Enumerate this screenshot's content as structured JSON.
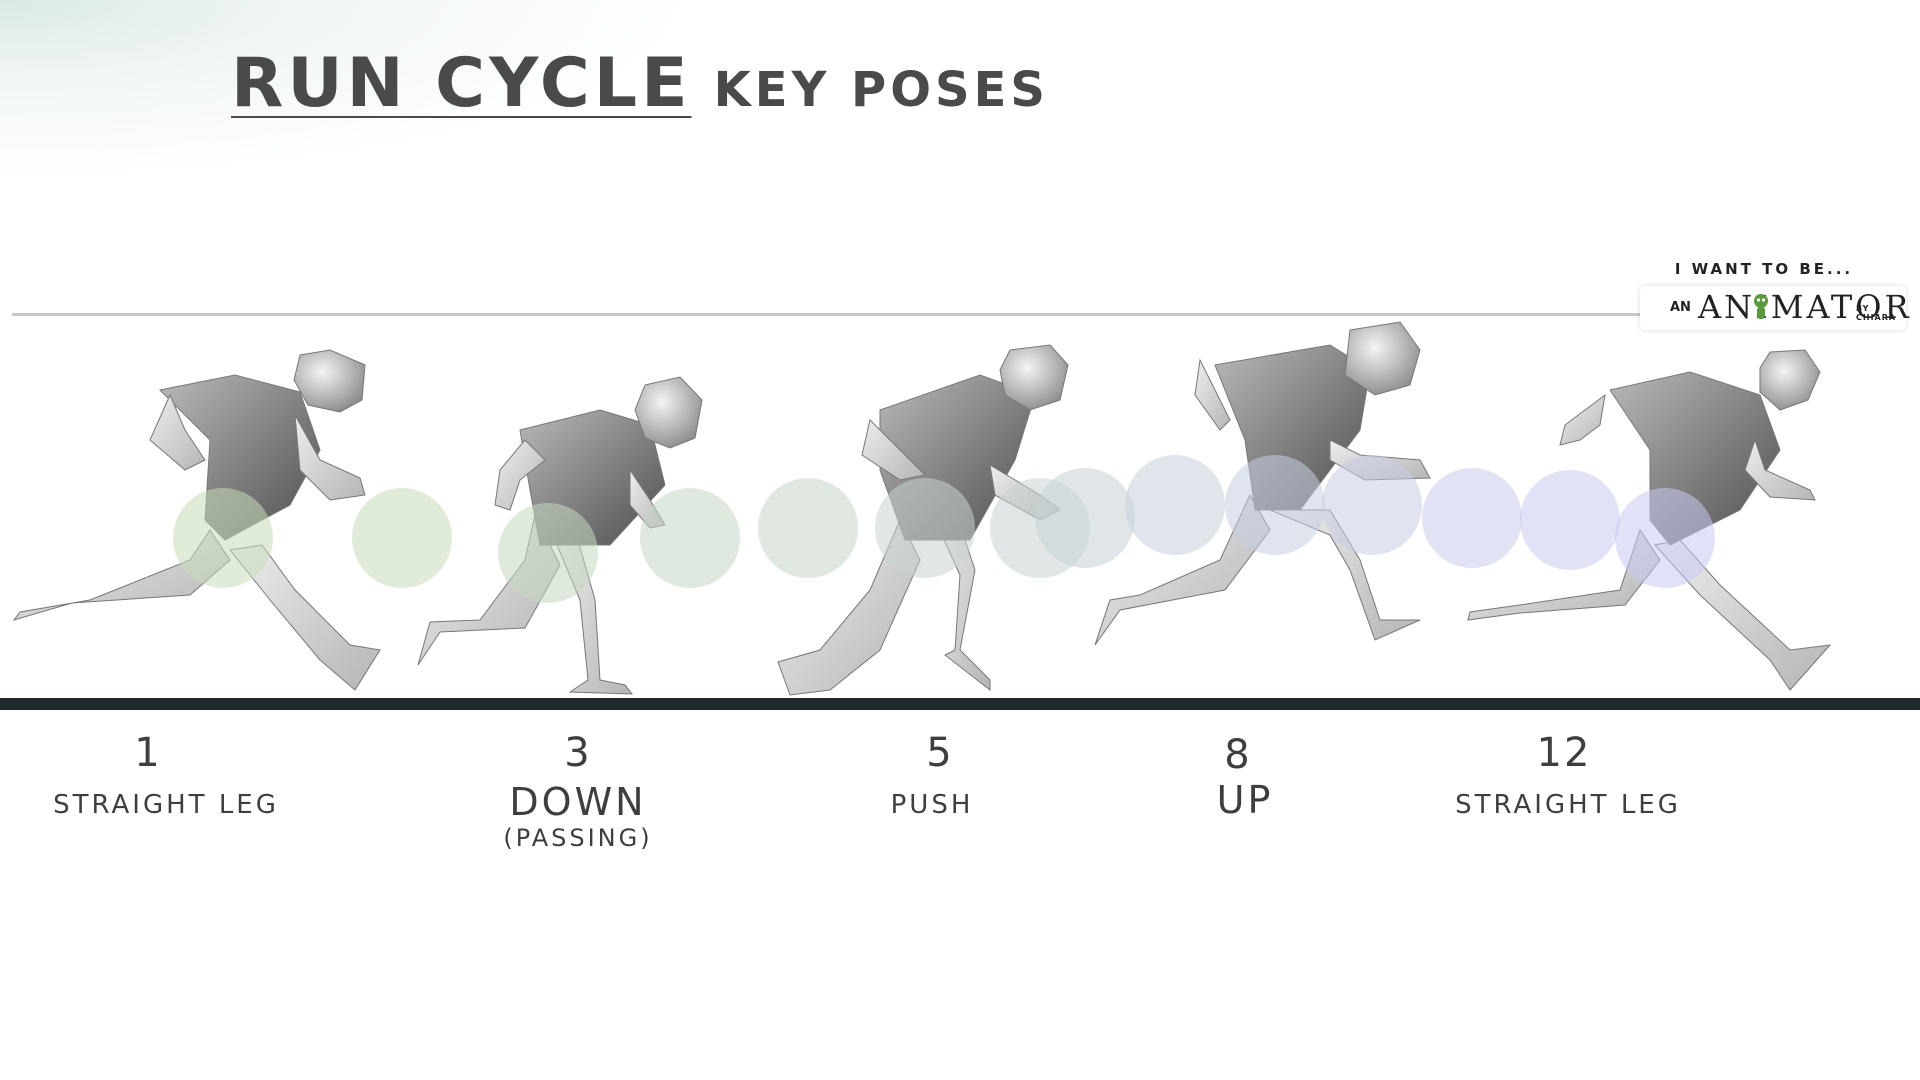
{
  "title": {
    "main": "RUN CYCLE",
    "sub": "KEY POSES"
  },
  "logo": {
    "tagline": "I WANT TO BE...",
    "prefix": "AN",
    "brand": "ANIMATOR",
    "byline": "BY CHIARA"
  },
  "poses": [
    {
      "frame": "1",
      "name": "STRAIGHT LEG",
      "note": ""
    },
    {
      "frame": "3",
      "name": "DOWN",
      "note": "(PASSING)"
    },
    {
      "frame": "5",
      "name": "PUSH",
      "note": ""
    },
    {
      "frame": "8",
      "name": "UP",
      "note": ""
    },
    {
      "frame": "12",
      "name": "STRAIGHT LEG",
      "note": ""
    }
  ],
  "colors": {
    "text": "#4a4a4a",
    "ground": "#1e2a30",
    "guide_line": "#c8c8c8",
    "trail_start": "#c6dcb6",
    "trail_end": "#c8c8f2"
  }
}
